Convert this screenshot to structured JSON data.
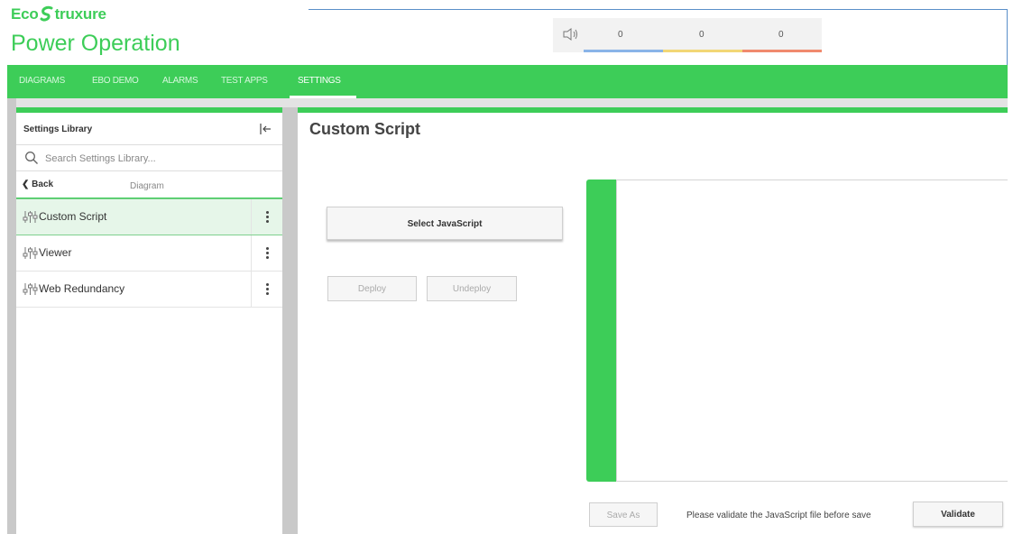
{
  "brand": {
    "eco_prefix": "Eco",
    "eco_suffix": "truxure",
    "app_name": "Power Operation",
    "accent_color": "#3dcd58"
  },
  "alarms": {
    "counts": [
      "0",
      "0",
      "0"
    ],
    "bar_colors": [
      "#8ab4e8",
      "#f2d776",
      "#f08a6e"
    ]
  },
  "nav": {
    "items": [
      {
        "label": "DIAGRAMS"
      },
      {
        "label": "EBO DEMO"
      },
      {
        "label": "ALARMS"
      },
      {
        "label": "TEST APPS"
      },
      {
        "label": "SETTINGS"
      }
    ],
    "active_index": 4
  },
  "settings_library": {
    "title": "Settings Library",
    "search_placeholder": "Search Settings Library...",
    "back_label": "Back",
    "breadcrumb": "Diagram",
    "items": [
      {
        "label": "Custom Script",
        "icon": "sliders-icon",
        "selected": true
      },
      {
        "label": "Viewer",
        "icon": "sliders-icon",
        "selected": false
      },
      {
        "label": "Web Redundancy",
        "icon": "sliders-icon",
        "selected": false
      }
    ]
  },
  "main": {
    "title": "Custom Script",
    "select_button": "Select JavaScript",
    "deploy_button": "Deploy",
    "undeploy_button": "Undeploy",
    "save_as_button": "Save As",
    "validate_message": "Please validate the JavaScript file before save",
    "validate_button": "Validate"
  }
}
